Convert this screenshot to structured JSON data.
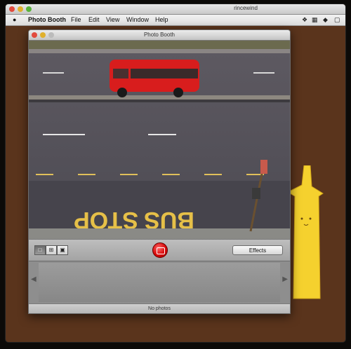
{
  "outer": {
    "user_label": "rincewind"
  },
  "menubar": {
    "apple": "",
    "app_name": "Photo Booth",
    "items": [
      "File",
      "Edit",
      "View",
      "Window",
      "Help"
    ]
  },
  "window": {
    "title": "Photo Booth"
  },
  "scene": {
    "road_text_1": "BUS",
    "road_text_2": "STOP"
  },
  "controls": {
    "view_buttons": [
      "single",
      "four-up",
      "filmstrip"
    ],
    "effects_label": "Effects"
  },
  "tray": {
    "status": "No photos"
  },
  "colors": {
    "desktop_brown": "#5a341c",
    "van_red": "#d81d1d",
    "shutter_red": "#d40000",
    "mascot_yellow": "#f5d12e"
  }
}
